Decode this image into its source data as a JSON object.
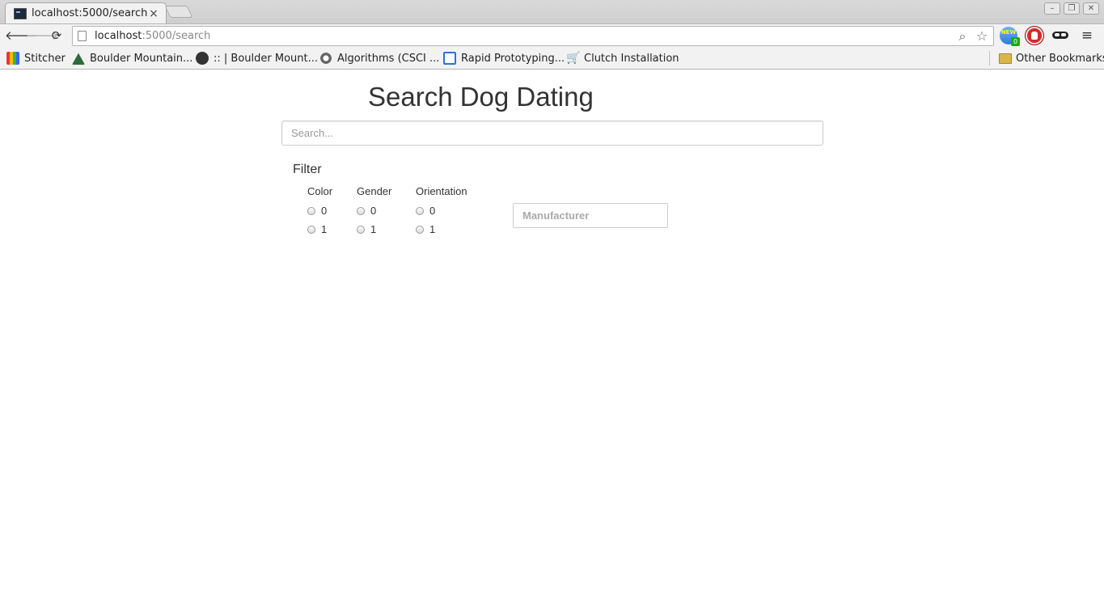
{
  "browser": {
    "tab": {
      "title": "localhost:5000/search",
      "close": "×"
    },
    "window_controls": {
      "minimize": "–",
      "restore": "❐",
      "close": "✕"
    },
    "nav": {
      "back": "🡐",
      "forward": "🡒",
      "reload": "⟳"
    },
    "address": {
      "host": "localhost",
      "path": ":5000/search"
    },
    "extensions": {
      "new_label": "NEW",
      "new_count": "0"
    },
    "menu": "≡",
    "bookmarks": [
      {
        "label": "Stitcher",
        "icon": "stitcher-icon"
      },
      {
        "label": "Boulder Mountain...",
        "icon": "mountain-icon"
      },
      {
        "label": ":: | Boulder Mount...",
        "icon": "dark-circle-icon"
      },
      {
        "label": "Algorithms (CSCI ...",
        "icon": "gear-icon"
      },
      {
        "label": "Rapid Prototyping...",
        "icon": "window-icon"
      },
      {
        "label": "Clutch Installation",
        "icon": "cart-icon"
      }
    ],
    "other_bookmarks": "Other Bookmarks"
  },
  "page": {
    "title": "Search Dog Dating",
    "search": {
      "placeholder": "Search...",
      "value": ""
    },
    "filter": {
      "title": "Filter",
      "groups": [
        {
          "name": "Color",
          "options": [
            "0",
            "1"
          ]
        },
        {
          "name": "Gender",
          "options": [
            "0",
            "1"
          ]
        },
        {
          "name": "Orientation",
          "options": [
            "0",
            "1"
          ]
        }
      ],
      "manufacturer": {
        "placeholder": "Manufacturer",
        "value": ""
      }
    }
  }
}
